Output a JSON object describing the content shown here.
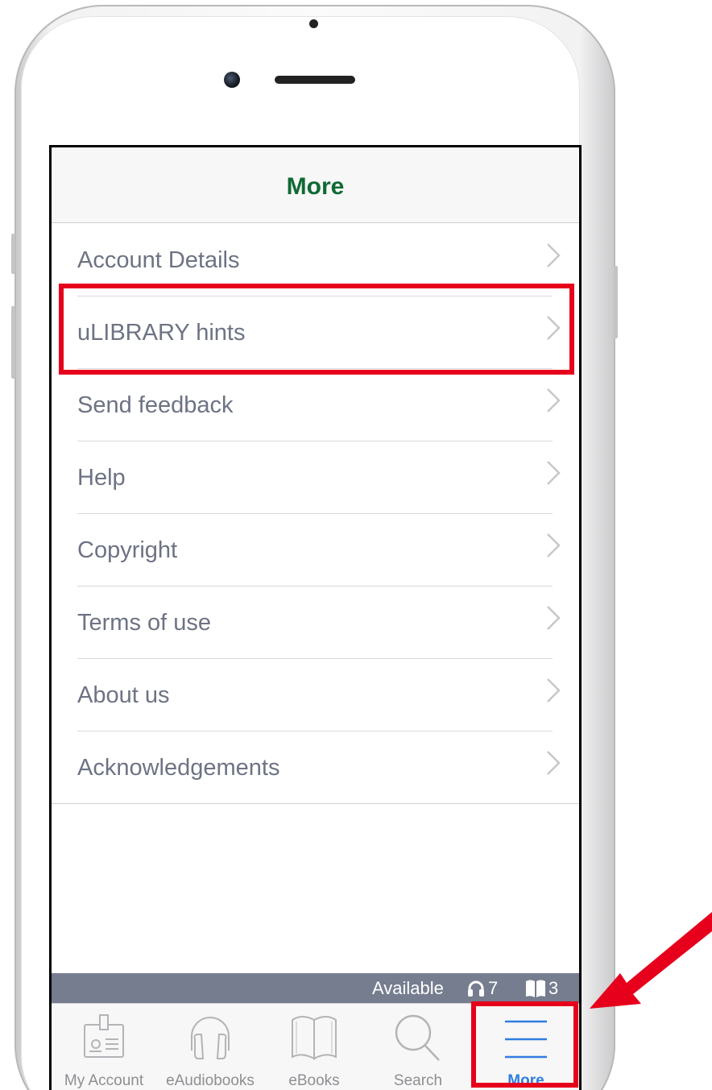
{
  "screen": {
    "title": "More"
  },
  "menu": {
    "items": [
      {
        "label": "Account Details"
      },
      {
        "label": "uLIBRARY hints"
      },
      {
        "label": "Send feedback"
      },
      {
        "label": "Help"
      },
      {
        "label": "Copyright"
      },
      {
        "label": "Terms of use"
      },
      {
        "label": "About us"
      },
      {
        "label": "Acknowledgements"
      }
    ]
  },
  "status_strip": {
    "label": "Available",
    "audiobooks_count": "7",
    "ebooks_count": "3",
    "icons": [
      "headphones-icon",
      "open-book-icon"
    ]
  },
  "tabbar": {
    "tabs": [
      {
        "label": "My Account",
        "icon": "id-card-icon"
      },
      {
        "label": "eAudiobooks",
        "icon": "headphones-icon"
      },
      {
        "label": "eBooks",
        "icon": "book-icon"
      },
      {
        "label": "Search",
        "icon": "magnifier-icon"
      },
      {
        "label": "More",
        "icon": "hamburger-icon",
        "active": true
      }
    ]
  },
  "colors": {
    "title_green": "#0f6a33",
    "tab_active_blue": "#2f7de1",
    "annotation_red": "#e6001c",
    "status_strip": "#757d8f"
  }
}
